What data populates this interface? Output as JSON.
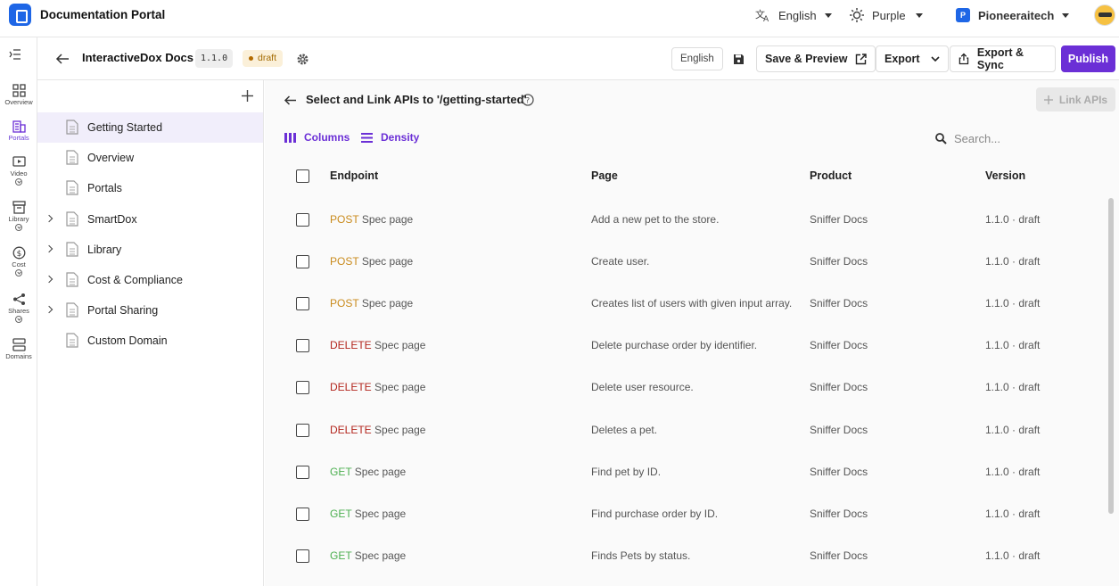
{
  "app": {
    "title": "Documentation Portal"
  },
  "topbar": {
    "language": "English",
    "theme": "Purple",
    "org": "Pioneeraitech",
    "org_initial": "P"
  },
  "leftnav": {
    "items": [
      {
        "label": "Overview",
        "icon": "grid-icon"
      },
      {
        "label": "Portals",
        "icon": "building-icon",
        "active": true
      },
      {
        "label": "Video",
        "icon": "video-icon"
      },
      {
        "label": "Library",
        "icon": "archive-icon"
      },
      {
        "label": "Cost",
        "icon": "dollar-icon"
      },
      {
        "label": "Shares",
        "icon": "share-icon"
      },
      {
        "label": "Domains",
        "icon": "server-icon"
      }
    ]
  },
  "header": {
    "doc_title": "InteractiveDox Docs",
    "version": "1.1.0",
    "status": "draft",
    "language_btn": "English",
    "save_preview": "Save & Preview",
    "export": "Export",
    "export_sync": "Export & Sync",
    "publish": "Publish"
  },
  "tree": {
    "items": [
      {
        "label": "Getting Started",
        "expandable": false,
        "active": true
      },
      {
        "label": "Overview",
        "expandable": false
      },
      {
        "label": "Portals",
        "expandable": false
      },
      {
        "label": "SmartDox",
        "expandable": true
      },
      {
        "label": "Library",
        "expandable": true
      },
      {
        "label": "Cost & Compliance",
        "expandable": true
      },
      {
        "label": "Portal Sharing",
        "expandable": true
      },
      {
        "label": "Custom Domain",
        "expandable": false
      }
    ]
  },
  "main": {
    "title": "Select and Link APIs to '/getting-started'",
    "link_apis": "Link APIs",
    "columns_btn": "Columns",
    "density_btn": "Density",
    "search_placeholder": "Search...",
    "headers": {
      "endpoint": "Endpoint",
      "page": "Page",
      "product": "Product",
      "version": "Version"
    },
    "rows": [
      {
        "method": "POST",
        "endpoint": "Spec page",
        "page": "Add a new pet to the store.",
        "product": "Sniffer Docs",
        "version": "1.1.0 · draft"
      },
      {
        "method": "POST",
        "endpoint": "Spec page",
        "page": "Create user.",
        "product": "Sniffer Docs",
        "version": "1.1.0 · draft"
      },
      {
        "method": "POST",
        "endpoint": "Spec page",
        "page": "Creates list of users with given input array.",
        "product": "Sniffer Docs",
        "version": "1.1.0 · draft"
      },
      {
        "method": "DELETE",
        "endpoint": "Spec page",
        "page": "Delete purchase order by identifier.",
        "product": "Sniffer Docs",
        "version": "1.1.0 · draft"
      },
      {
        "method": "DELETE",
        "endpoint": "Spec page",
        "page": "Delete user resource.",
        "product": "Sniffer Docs",
        "version": "1.1.0 · draft"
      },
      {
        "method": "DELETE",
        "endpoint": "Spec page",
        "page": "Deletes a pet.",
        "product": "Sniffer Docs",
        "version": "1.1.0 · draft"
      },
      {
        "method": "GET",
        "endpoint": "Spec page",
        "page": "Find pet by ID.",
        "product": "Sniffer Docs",
        "version": "1.1.0 · draft"
      },
      {
        "method": "GET",
        "endpoint": "Spec page",
        "page": "Find purchase order by ID.",
        "product": "Sniffer Docs",
        "version": "1.1.0 · draft"
      },
      {
        "method": "GET",
        "endpoint": "Spec page",
        "page": "Finds Pets by status.",
        "product": "Sniffer Docs",
        "version": "1.1.0 · draft"
      }
    ]
  },
  "colors": {
    "accent": "#6b2fd6",
    "post": "#c98a1b",
    "delete": "#b3261e",
    "get": "#4caf50"
  }
}
